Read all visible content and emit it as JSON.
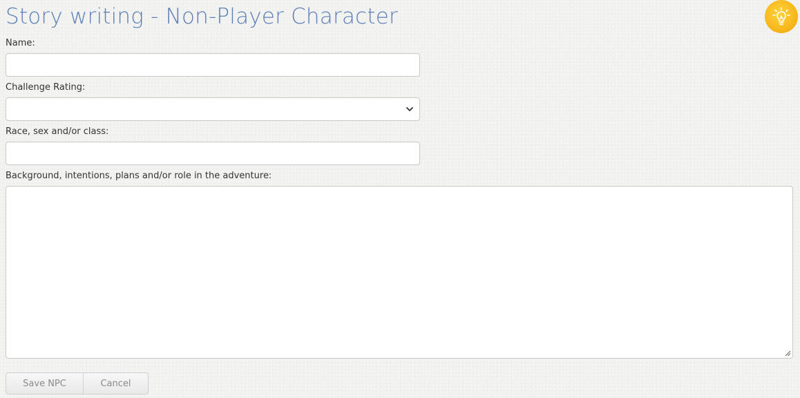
{
  "header": {
    "title": "Story writing - Non-Player Character"
  },
  "hint": {
    "icon": "lightbulb-icon",
    "color": "#f7b81c"
  },
  "form": {
    "name": {
      "label": "Name:",
      "value": ""
    },
    "challenge_rating": {
      "label": "Challenge Rating:",
      "value": ""
    },
    "race": {
      "label": "Race, sex and/or class:",
      "value": ""
    },
    "background": {
      "label": "Background, intentions, plans and/or role in the adventure:",
      "value": ""
    }
  },
  "actions": {
    "save_label": "Save NPC",
    "cancel_label": "Cancel"
  },
  "colors": {
    "title": "#5b7fb6",
    "button_text": "#8a8a8a"
  }
}
